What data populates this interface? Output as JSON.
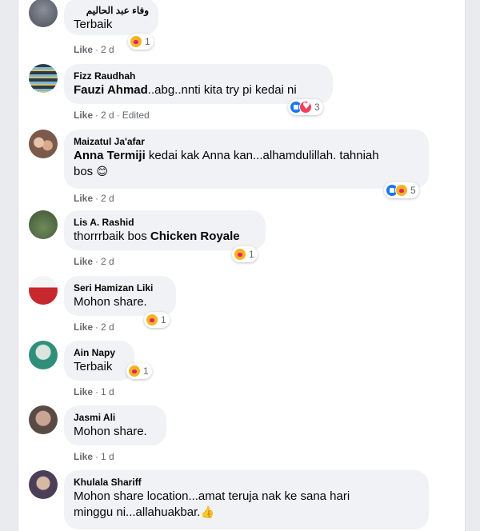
{
  "labels": {
    "like": "Like",
    "dot": "·"
  },
  "comments": [
    {
      "author": "وفاء عبد الحاليم",
      "text": "Terbaik",
      "time": "2 d",
      "reactions": {
        "count": "1"
      }
    },
    {
      "author": "Fizz Raudhah",
      "tag": "Fauzi Ahmad",
      "text": "..abg..nnti kita try pi kedai ni",
      "time": "2 d",
      "edited": "Edited",
      "reactions": {
        "count": "3"
      }
    },
    {
      "author": "Maizatul Ja'afar",
      "tag": "Anna Termiji",
      "text": " kedai kak Anna kan...alhamdulillah. tahniah",
      "text2": "bos",
      "emoji": "😊",
      "time": "2 d",
      "reactions": {
        "count": "5"
      }
    },
    {
      "author": "Lis A. Rashid",
      "text": "thorrrbaik bos ",
      "tag": "Chicken Royale",
      "time": "2 d",
      "reactions": {
        "count": "1"
      }
    },
    {
      "author": "Seri Hamizan Liki",
      "text": "Mohon share.",
      "time": "2 d",
      "reactions": {
        "count": "1"
      }
    },
    {
      "author": "Ain Napy",
      "text": "Terbaik",
      "time": "1 d",
      "reactions": {
        "count": "1"
      }
    },
    {
      "author": "Jasmi Ali",
      "text": "Mohon share.",
      "time": "1 d"
    },
    {
      "author": "Khulala Shariff",
      "text": "Mohon share location...amat teruja nak ke sana hari",
      "text2": "minggu ni...allahuakbar.",
      "emoji": "👍"
    }
  ]
}
